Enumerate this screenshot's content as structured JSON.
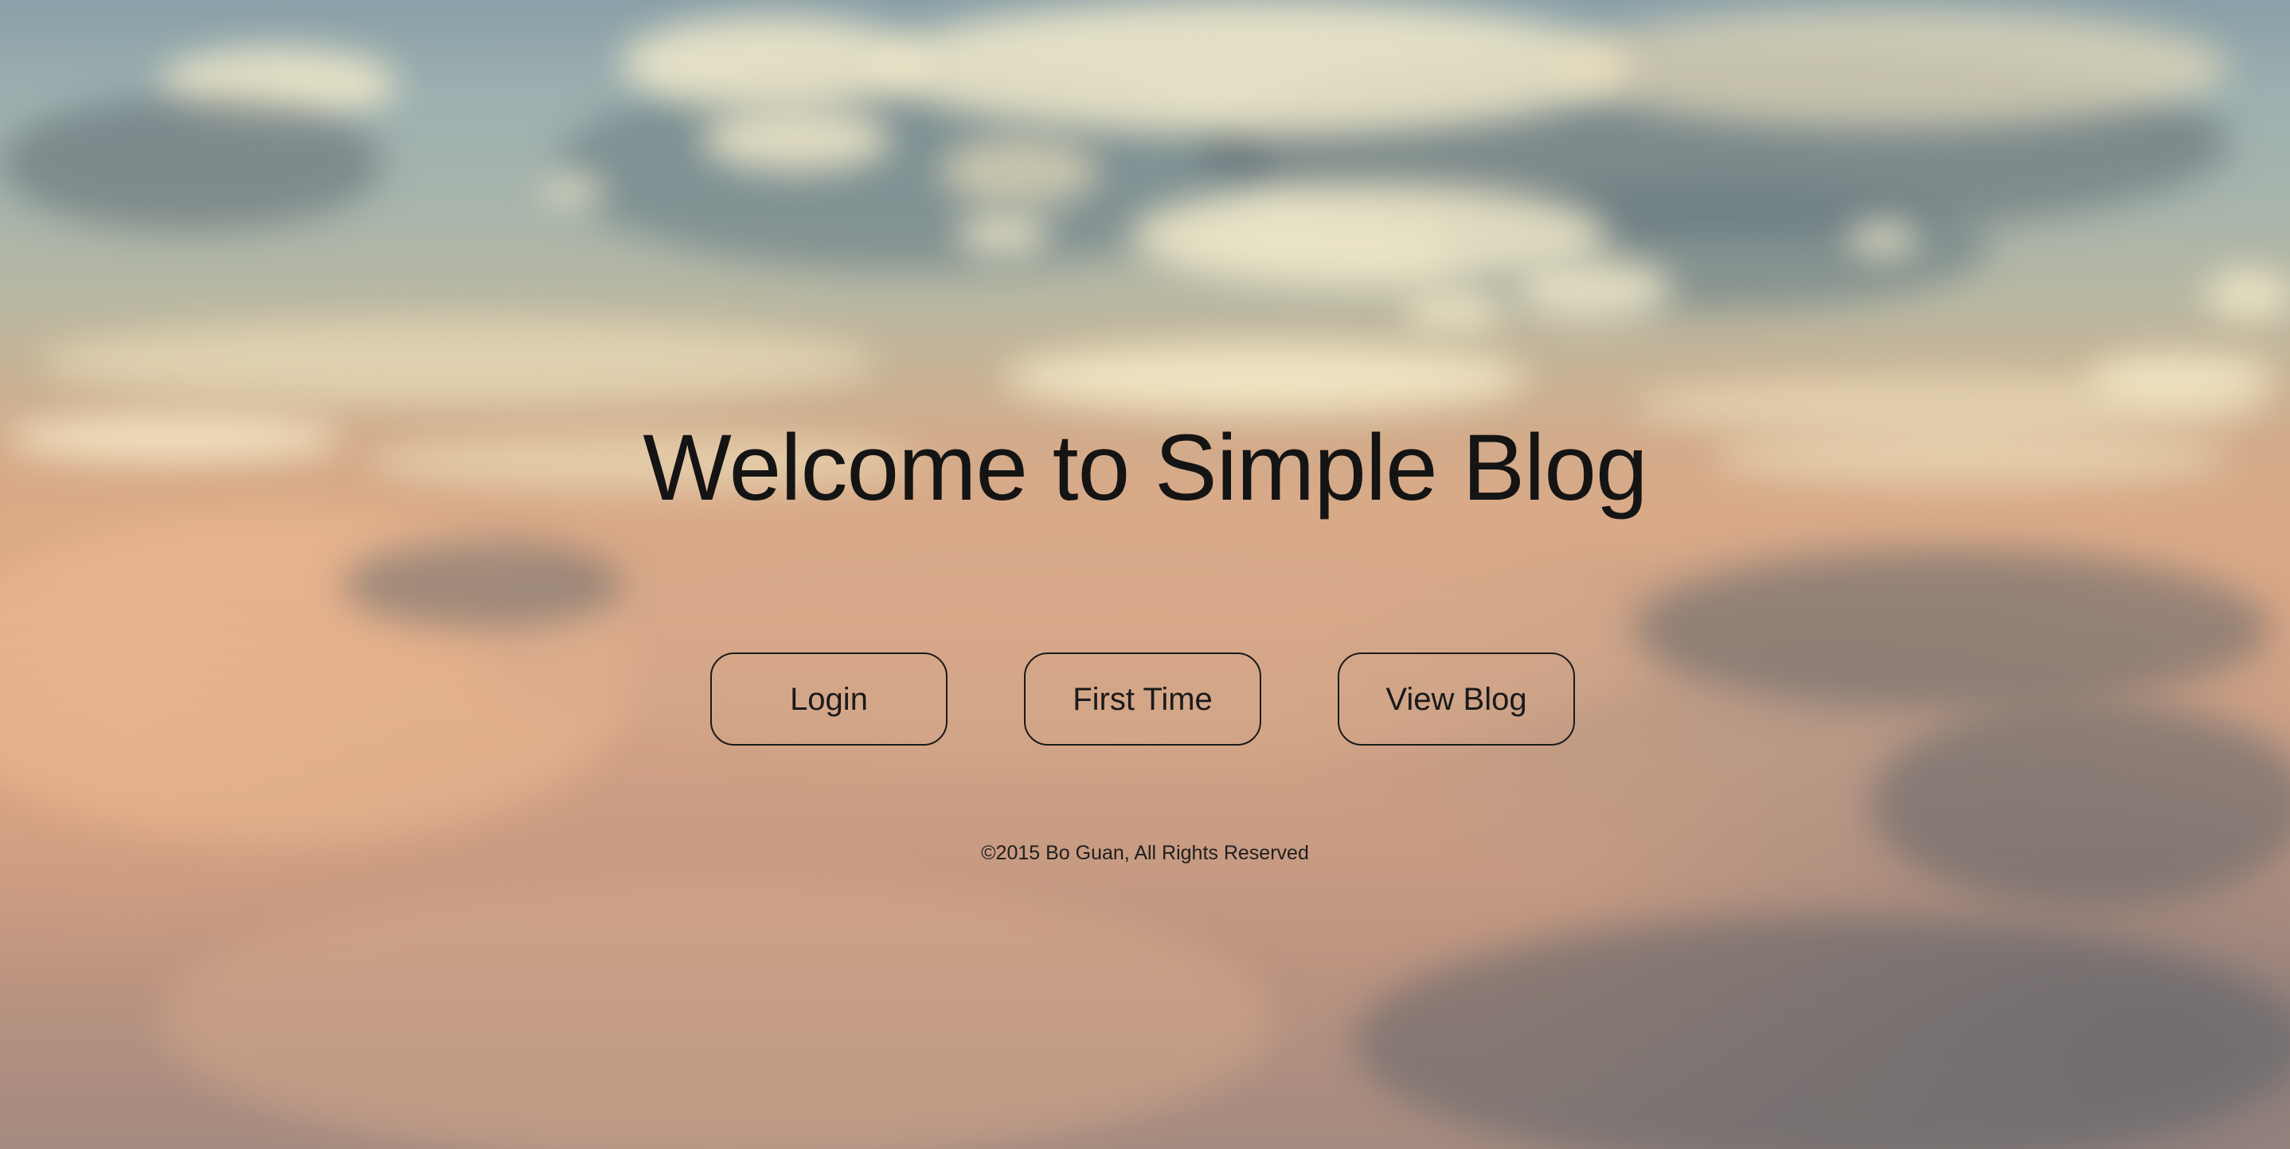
{
  "hero": {
    "title": "Welcome to Simple Blog"
  },
  "actions": {
    "login_label": "Login",
    "first_time_label": "First Time",
    "view_blog_label": "View Blog"
  },
  "footer": {
    "copyright": "©2015 Bo Guan, All Rights Reserved"
  },
  "colors": {
    "text": "#141414",
    "button_border": "#1a1a1a",
    "sky_top": "#8a9fa8",
    "cloud_peach": "#d9aa88"
  }
}
